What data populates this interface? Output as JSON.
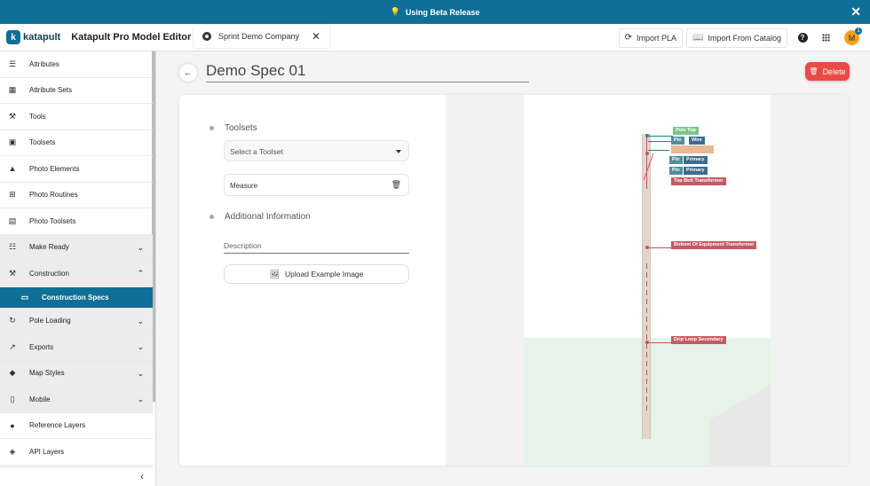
{
  "banner": {
    "text": "Using Beta Release"
  },
  "header": {
    "logo_text": "katapult",
    "app_title": "Katapult Pro Model Editor",
    "company": "Sprint Demo Company",
    "import_pla": "Import PLA",
    "import_catalog": "Import From Catalog",
    "avatar_initial": "M",
    "avatar_badge": "1"
  },
  "sidebar": {
    "items": [
      {
        "label": "Attributes",
        "icon": "list-icon"
      },
      {
        "label": "Attribute Sets",
        "icon": "table-icon"
      },
      {
        "label": "Tools",
        "icon": "tools-icon"
      },
      {
        "label": "Toolsets",
        "icon": "toolbox-icon"
      },
      {
        "label": "Photo Elements",
        "icon": "shapes-icon"
      },
      {
        "label": "Photo Routines",
        "icon": "add-box-icon"
      },
      {
        "label": "Photo Toolsets",
        "icon": "photo-library-icon"
      },
      {
        "label": "Make Ready",
        "icon": "checklist-icon"
      },
      {
        "label": "Construction",
        "icon": "construction-icon"
      },
      {
        "label": "Construction Specs",
        "icon": "ruler-icon"
      },
      {
        "label": "Pole Loading",
        "icon": "3d-rotation-icon"
      },
      {
        "label": "Exports",
        "icon": "trending-icon"
      },
      {
        "label": "Map Styles",
        "icon": "map-icon"
      },
      {
        "label": "Mobile",
        "icon": "phone-icon"
      },
      {
        "label": "Reference Layers",
        "icon": "location-pin-icon"
      },
      {
        "label": "API Layers",
        "icon": "layers-icon"
      }
    ]
  },
  "spec": {
    "title": "Demo Spec 01",
    "delete_label": "Delete",
    "toolsets_heading": "Toolsets",
    "toolset_placeholder": "Select a Toolset",
    "toolset_chip": "Measure",
    "additional_heading": "Additional Information",
    "description_placeholder": "Description",
    "upload_label": "Upload Example Image"
  },
  "model": {
    "labels": {
      "pole_top": "Pole Top",
      "pin1": "Pin",
      "wire": "Wire",
      "pin2": "Pin",
      "primary1": "Primary",
      "pin3": "Pin",
      "primary2": "Primary",
      "top_bolt": "Top Bolt Transformer",
      "bottom_equipment": "Bottom Of Equipment Transformer",
      "drip_loop": "Drip Loop Secondary"
    }
  },
  "colors": {
    "brand": "#0f6f96",
    "delete": "#e84b45",
    "avatar": "#f3a31b"
  }
}
